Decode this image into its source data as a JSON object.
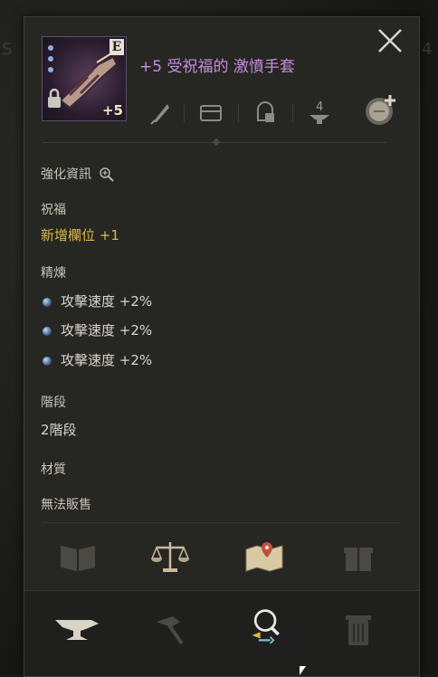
{
  "item": {
    "name": "+5 受祝福的 激憤手套",
    "grade": "E",
    "enhance": "+5"
  },
  "enhance_info": {
    "label": "強化資訊"
  },
  "blessing": {
    "label": "祝福",
    "value": "新增欄位 +1"
  },
  "refine": {
    "label": "精煉",
    "stats": [
      {
        "text": "攻擊速度 +2%"
      },
      {
        "text": "攻擊速度 +2%"
      },
      {
        "text": "攻擊速度 +2%"
      }
    ]
  },
  "tier": {
    "label": "階段",
    "value": "2階段"
  },
  "material": {
    "label": "材質"
  },
  "trade": {
    "value": "無法販售"
  },
  "colors": {
    "name": "#c68ce0",
    "gold": "#d9b94a",
    "panel": "#262623"
  },
  "icons": {
    "top_row": [
      "quill-icon",
      "chest-icon",
      "lock-refine-icon",
      "anvil-4-icon",
      "add-chat-icon"
    ],
    "actions": [
      "book-icon",
      "scale-icon",
      "map-icon",
      "gift-box-icon"
    ],
    "bottom": [
      "anvil-icon",
      "hammer-icon",
      "magnify-swap-icon",
      "trash-icon"
    ]
  }
}
